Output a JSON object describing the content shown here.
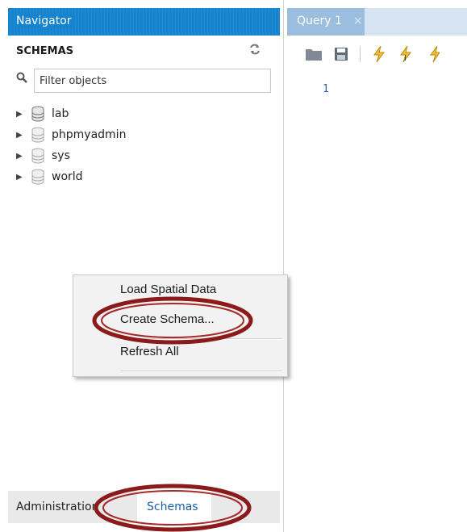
{
  "navigator": {
    "title": "Navigator",
    "schemas_header": "SCHEMAS",
    "filter_placeholder": "Filter objects",
    "schemas": [
      {
        "label": "lab"
      },
      {
        "label": "phpmyadmin"
      },
      {
        "label": "sys"
      },
      {
        "label": "world"
      }
    ]
  },
  "context_menu": {
    "items": [
      "Load Spatial Data",
      "Create Schema...",
      "Refresh All"
    ]
  },
  "bottom_tabs": {
    "administration": "Administration",
    "schemas": "Schemas"
  },
  "editor": {
    "tab_label": "Query 1",
    "tab_close": "×",
    "line_numbers": [
      "1"
    ]
  },
  "colors": {
    "accent": "#1683cf",
    "annotation": "#8b1a1a"
  }
}
